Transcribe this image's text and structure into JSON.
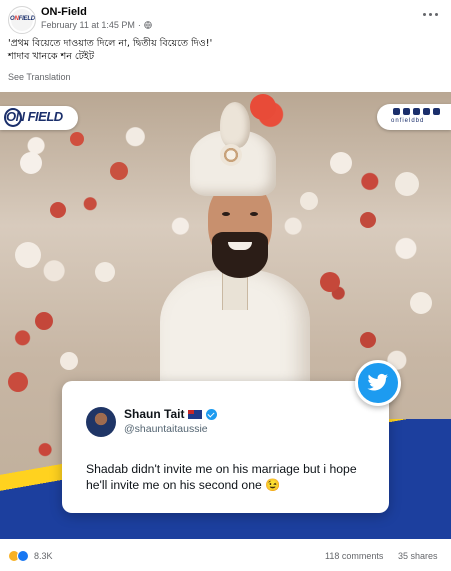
{
  "post": {
    "page_name": "ON-Field",
    "timestamp": "February 11 at 1:45 PM",
    "separator": "·",
    "caption_line1": "'প্রথম বিয়েতে দাওয়াত দিলে না, দ্বিতীয় বিয়েতে দিও!'",
    "caption_line2": "শাদাব খানকে শন টেইট",
    "see_translation": "See Translation"
  },
  "media": {
    "brand_logo": "ON FIELD",
    "brand_handle": "onfieldbd",
    "tweet": {
      "author_name": "Shaun Tait",
      "author_handle": "@shauntaitaussie",
      "text": "Shadab didn't invite me on his marriage but i hope he'll invite me on his second one 😉"
    }
  },
  "engagement": {
    "reactions": "8.3K",
    "comments": "118 comments",
    "shares": "35 shares"
  },
  "colors": {
    "brand_navy": "#1b2f6b",
    "twitter_blue": "#1d9bf0",
    "band_yellow": "#ffd21f",
    "band_blue": "#1c3f9e"
  }
}
